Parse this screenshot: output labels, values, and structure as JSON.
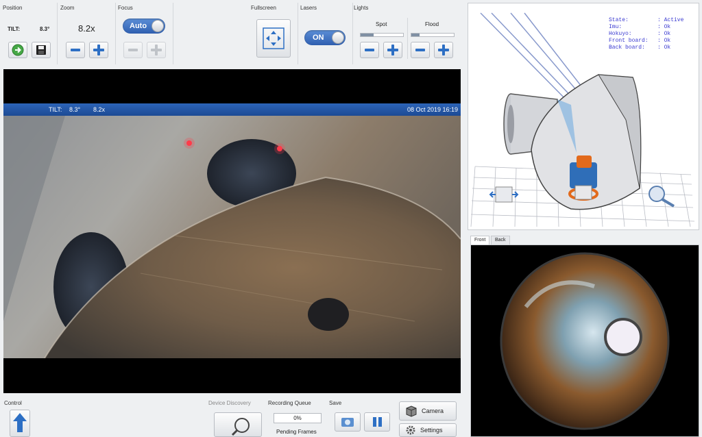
{
  "position": {
    "title": "Position",
    "tilt_label": "TILT:",
    "tilt_value": "8.3°"
  },
  "zoom": {
    "title": "Zoom",
    "value": "8.2x"
  },
  "focus": {
    "title": "Focus",
    "auto_label": "Auto"
  },
  "fullscreen": {
    "title": "Fullscreen"
  },
  "lasers": {
    "title": "Lasers",
    "on_label": "ON"
  },
  "lights": {
    "title": "Lights",
    "spot_label": "Spot",
    "flood_label": "Flood",
    "spot_level": 0.3,
    "flood_level": 0.2
  },
  "video": {
    "tilt_label": "TILT:",
    "tilt_value": "8.3°",
    "zoom_value": "8.2x",
    "timestamp": "08 Oct 2019 16:19"
  },
  "status": {
    "rows": [
      {
        "key": "State:",
        "value": ": Active"
      },
      {
        "key": "Imu:",
        "value": ": Ok"
      },
      {
        "key": "Hokuyo:",
        "value": ": Ok"
      },
      {
        "key": "Front board:",
        "value": ": Ok"
      },
      {
        "key": "Back board:",
        "value": ": Ok"
      }
    ]
  },
  "camera_tabs": [
    {
      "label": "Front",
      "active": true
    },
    {
      "label": "Back",
      "active": false
    }
  ],
  "bottom": {
    "control_title": "Control",
    "device_discovery_title": "Device Discovery",
    "recording_queue_title": "Recording Queue",
    "queue_percent": "0%",
    "pending_frames_label": "Pending Frames",
    "save_title": "Save",
    "camera_label": "Camera",
    "settings_label": "Settings"
  },
  "colors": {
    "accent": "#2d6fc4",
    "status_text": "#3a3ad0",
    "video_bar": "#1c4a94"
  }
}
